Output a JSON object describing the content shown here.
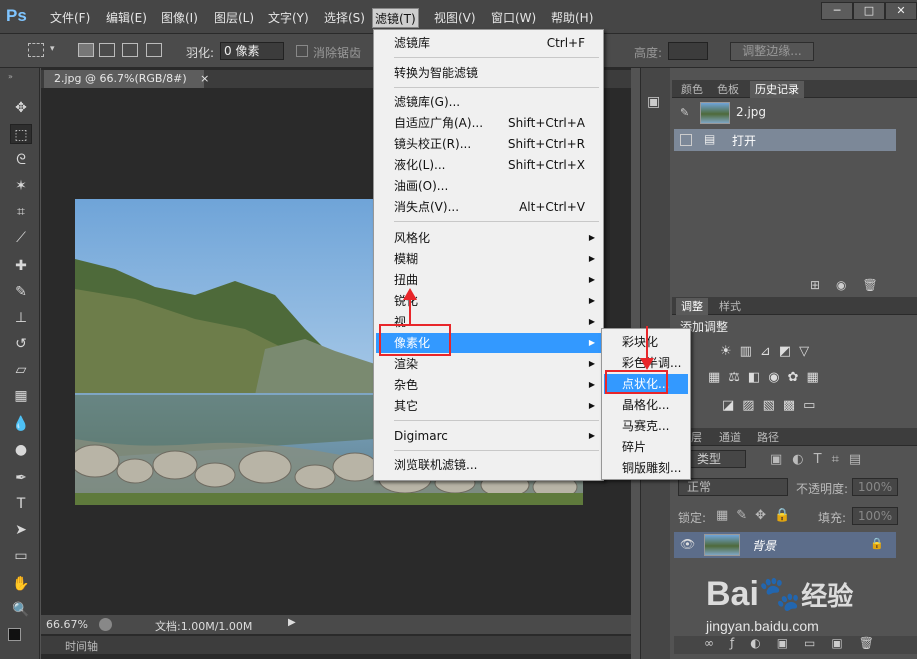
{
  "app": {
    "logo": "Ps"
  },
  "menubar": {
    "items": [
      "文件(F)",
      "编辑(E)",
      "图像(I)",
      "图层(L)",
      "文字(Y)",
      "选择(S)",
      "滤镜(T)",
      "视图(V)",
      "窗口(W)",
      "帮助(H)"
    ],
    "active": "滤镜(T)"
  },
  "window_controls": {
    "minimize": "─",
    "maximize": "□",
    "close": "✕"
  },
  "options_bar": {
    "feather_label": "羽化:",
    "feather_value": "0 像素",
    "antialias_label": "消除锯齿",
    "height_label": "高度:",
    "refine_edge_label": "调整边缘..."
  },
  "document": {
    "tab_title": "2.jpg @ 66.7%(RGB/8#)",
    "tab_close": "×",
    "zoom": "66.67%",
    "doc_info": "文档:1.00M/1.00M",
    "timeline_label": "时间轴"
  },
  "filter_menu": {
    "items": [
      {
        "label": "滤镜库",
        "shortcut": "Ctrl+F"
      },
      {
        "label": "转换为智能滤镜",
        "shortcut": ""
      },
      {
        "label": "滤镜库(G)...",
        "shortcut": ""
      },
      {
        "label": "自适应广角(A)...",
        "shortcut": "Shift+Ctrl+A"
      },
      {
        "label": "镜头校正(R)...",
        "shortcut": "Shift+Ctrl+R"
      },
      {
        "label": "液化(L)...",
        "shortcut": "Shift+Ctrl+X"
      },
      {
        "label": "油画(O)...",
        "shortcut": ""
      },
      {
        "label": "消失点(V)...",
        "shortcut": "Alt+Ctrl+V"
      },
      {
        "label": "风格化",
        "shortcut": ""
      },
      {
        "label": "模糊",
        "shortcut": ""
      },
      {
        "label": "扭曲",
        "shortcut": ""
      },
      {
        "label": "锐化",
        "shortcut": ""
      },
      {
        "label": "视",
        "shortcut": ""
      },
      {
        "label": "像素化",
        "shortcut": ""
      },
      {
        "label": "渲染",
        "shortcut": ""
      },
      {
        "label": "杂色",
        "shortcut": ""
      },
      {
        "label": "其它",
        "shortcut": ""
      },
      {
        "label": "Digimarc",
        "shortcut": ""
      },
      {
        "label": "浏览联机滤镜...",
        "shortcut": ""
      }
    ],
    "highlighted": "像素化"
  },
  "pixelate_submenu": {
    "items": [
      "彩块化",
      "彩色半调...",
      "点状化...",
      "晶格化...",
      "马赛克...",
      "碎片",
      "铜版雕刻..."
    ],
    "highlighted": "点状化..."
  },
  "panels": {
    "top_tabs": [
      "颜色",
      "色板",
      "历史记录"
    ],
    "history": {
      "snapshot": "2.jpg",
      "step": "打开"
    },
    "adjust_tabs": [
      "调整",
      "样式"
    ],
    "adjust_title": "添加调整",
    "layers_tabs": [
      "层",
      "通道",
      "路径"
    ],
    "kind_label": "类型",
    "blend_mode": "正常",
    "opacity_label": "不透明度:",
    "opacity_value": "100%",
    "lock_label": "锁定:",
    "fill_label": "填充:",
    "fill_value": "100%",
    "layer_name": "背景"
  },
  "watermark": {
    "brand": "Bai",
    "brand2": "经验",
    "url": "jingyan.baidu.com"
  },
  "colors": {
    "menu_highlight": "#3399ff",
    "annotation_red": "#e8262a",
    "ps_blue": "#7fc5ff"
  }
}
